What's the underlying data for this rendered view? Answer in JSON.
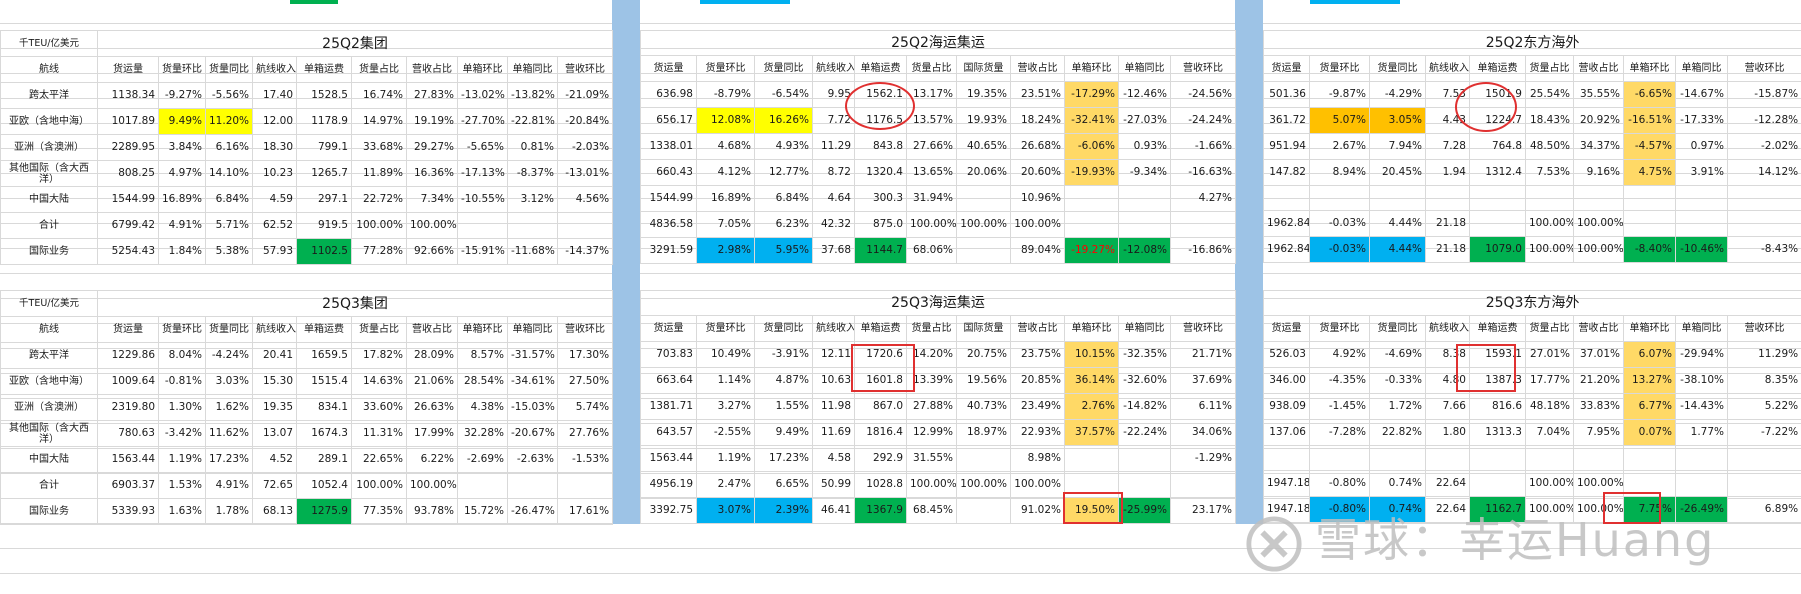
{
  "unit_label": "千TEU/亿美元",
  "route_header": "航线",
  "routes": [
    "跨太平洋",
    "亚欧（含地中海）",
    "亚洲（含澳洲）",
    "其他国际（含大西洋）",
    "中国大陆",
    "合计",
    "国际业务"
  ],
  "headers": {
    "group": [
      "货运量",
      "货量环比",
      "货量同比",
      "航线收入",
      "单箱运费",
      "货量占比",
      "营收占比",
      "单箱环比",
      "单箱同比",
      "营收环比"
    ],
    "sea": [
      "货运量",
      "货量环比",
      "货量同比",
      "航线收入",
      "单箱运费",
      "货量占比",
      "国际货量",
      "营收占比",
      "单箱环比",
      "单箱同比",
      "营收环比"
    ],
    "east": [
      "货运量",
      "货量环比",
      "货量同比",
      "航线收入",
      "单箱运费",
      "货量占比",
      "营收占比",
      "单箱环比",
      "单箱同比",
      "营收环比"
    ]
  },
  "q2": {
    "group_title": "25Q2集团",
    "sea_title": "25Q2海运集运",
    "east_title": "25Q2东方海外",
    "group_rows": [
      [
        "1138.34",
        "-9.27%",
        "-5.56%",
        "17.40",
        "1528.5",
        "16.74%",
        "27.83%",
        "-13.02%",
        "-13.82%",
        "-21.09%"
      ],
      [
        "1017.89",
        "9.49%",
        "11.20%",
        "12.00",
        "1178.9",
        "14.97%",
        "19.19%",
        "-27.70%",
        "-22.81%",
        "-20.84%"
      ],
      [
        "2289.95",
        "3.84%",
        "6.16%",
        "18.30",
        "799.1",
        "33.68%",
        "29.27%",
        "-5.65%",
        "0.81%",
        "-2.03%"
      ],
      [
        "808.25",
        "4.97%",
        "14.10%",
        "10.23",
        "1265.7",
        "11.89%",
        "16.36%",
        "-17.13%",
        "-8.37%",
        "-13.01%"
      ],
      [
        "1544.99",
        "16.89%",
        "6.84%",
        "4.59",
        "297.1",
        "22.72%",
        "7.34%",
        "-10.55%",
        "3.12%",
        "4.56%"
      ],
      [
        "6799.42",
        "4.91%",
        "5.71%",
        "62.52",
        "919.5",
        "100.00%",
        "100.00%",
        "",
        "",
        ""
      ],
      [
        "5254.43",
        "1.84%",
        "5.38%",
        "57.93",
        "1102.5",
        "77.28%",
        "92.66%",
        "-15.91%",
        "-11.68%",
        "-14.37%"
      ]
    ],
    "sea_rows": [
      [
        "636.98",
        "-8.79%",
        "-6.54%",
        "9.95",
        "1562.1",
        "13.17%",
        "19.35%",
        "23.51%",
        "-17.29%",
        "-12.46%",
        "-24.56%"
      ],
      [
        "656.17",
        "12.08%",
        "16.26%",
        "7.72",
        "1176.5",
        "13.57%",
        "19.93%",
        "18.24%",
        "-32.41%",
        "-27.03%",
        "-24.24%"
      ],
      [
        "1338.01",
        "4.68%",
        "4.93%",
        "11.29",
        "843.8",
        "27.66%",
        "40.65%",
        "26.68%",
        "-6.06%",
        "0.93%",
        "-1.66%"
      ],
      [
        "660.43",
        "4.12%",
        "12.77%",
        "8.72",
        "1320.4",
        "13.65%",
        "20.06%",
        "20.60%",
        "-19.93%",
        "-9.34%",
        "-16.63%"
      ],
      [
        "1544.99",
        "16.89%",
        "6.84%",
        "4.64",
        "300.3",
        "31.94%",
        "",
        "10.96%",
        "",
        "",
        "4.27%"
      ],
      [
        "4836.58",
        "7.05%",
        "6.23%",
        "42.32",
        "875.0",
        "100.00%",
        "100.00%",
        "100.00%",
        "",
        "",
        ""
      ],
      [
        "3291.59",
        "2.98%",
        "5.95%",
        "37.68",
        "1144.7",
        "68.06%",
        "",
        "89.04%",
        "-19.27%",
        "-12.08%",
        "-16.86%"
      ]
    ],
    "east_rows": [
      [
        "501.36",
        "-9.87%",
        "-4.29%",
        "7.53",
        "1501.9",
        "25.54%",
        "35.55%",
        "-6.65%",
        "-14.67%",
        "-15.87%"
      ],
      [
        "361.72",
        "5.07%",
        "3.05%",
        "4.43",
        "1224.7",
        "18.43%",
        "20.92%",
        "-16.51%",
        "-17.33%",
        "-12.28%"
      ],
      [
        "951.94",
        "2.67%",
        "7.94%",
        "7.28",
        "764.8",
        "48.50%",
        "34.37%",
        "-4.57%",
        "0.97%",
        "-2.02%"
      ],
      [
        "147.82",
        "8.94%",
        "20.45%",
        "1.94",
        "1312.4",
        "7.53%",
        "9.16%",
        "4.75%",
        "3.91%",
        "14.12%"
      ],
      [
        "",
        "",
        "",
        "",
        "",
        "",
        "",
        "",
        "",
        ""
      ],
      [
        "1962.84",
        "-0.03%",
        "4.44%",
        "21.18",
        "",
        "100.00%",
        "100.00%",
        "",
        "",
        ""
      ],
      [
        "1962.84",
        "-0.03%",
        "4.44%",
        "21.18",
        "1079.0",
        "100.00%",
        "100.00%",
        "-8.40%",
        "-10.46%",
        "-8.43%"
      ]
    ]
  },
  "q3": {
    "group_title": "25Q3集团",
    "sea_title": "25Q3海运集运",
    "east_title": "25Q3东方海外",
    "group_rows": [
      [
        "1229.86",
        "8.04%",
        "-4.24%",
        "20.41",
        "1659.5",
        "17.82%",
        "28.09%",
        "8.57%",
        "-31.57%",
        "17.30%"
      ],
      [
        "1009.64",
        "-0.81%",
        "3.03%",
        "15.30",
        "1515.4",
        "14.63%",
        "21.06%",
        "28.54%",
        "-34.61%",
        "27.50%"
      ],
      [
        "2319.80",
        "1.30%",
        "1.62%",
        "19.35",
        "834.1",
        "33.60%",
        "26.63%",
        "4.38%",
        "-15.03%",
        "5.74%"
      ],
      [
        "780.63",
        "-3.42%",
        "11.62%",
        "13.07",
        "1674.3",
        "11.31%",
        "17.99%",
        "32.28%",
        "-20.67%",
        "27.76%"
      ],
      [
        "1563.44",
        "1.19%",
        "17.23%",
        "4.52",
        "289.1",
        "22.65%",
        "6.22%",
        "-2.69%",
        "-2.63%",
        "-1.53%"
      ],
      [
        "6903.37",
        "1.53%",
        "4.91%",
        "72.65",
        "1052.4",
        "100.00%",
        "100.00%",
        "",
        "",
        ""
      ],
      [
        "5339.93",
        "1.63%",
        "1.78%",
        "68.13",
        "1275.9",
        "77.35%",
        "93.78%",
        "15.72%",
        "-26.47%",
        "17.61%"
      ]
    ],
    "sea_rows": [
      [
        "703.83",
        "10.49%",
        "-3.91%",
        "12.11",
        "1720.6",
        "14.20%",
        "20.75%",
        "23.75%",
        "10.15%",
        "-32.35%",
        "21.71%"
      ],
      [
        "663.64",
        "1.14%",
        "4.87%",
        "10.63",
        "1601.8",
        "13.39%",
        "19.56%",
        "20.85%",
        "36.14%",
        "-32.60%",
        "37.69%"
      ],
      [
        "1381.71",
        "3.27%",
        "1.55%",
        "11.98",
        "867.0",
        "27.88%",
        "40.73%",
        "23.49%",
        "2.76%",
        "-14.82%",
        "6.11%"
      ],
      [
        "643.57",
        "-2.55%",
        "9.49%",
        "11.69",
        "1816.4",
        "12.99%",
        "18.97%",
        "22.93%",
        "37.57%",
        "-22.24%",
        "34.06%"
      ],
      [
        "1563.44",
        "1.19%",
        "17.23%",
        "4.58",
        "292.9",
        "31.55%",
        "",
        "8.98%",
        "",
        "",
        "-1.29%"
      ],
      [
        "4956.19",
        "2.47%",
        "6.65%",
        "50.99",
        "1028.8",
        "100.00%",
        "100.00%",
        "100.00%",
        "",
        "",
        ""
      ],
      [
        "3392.75",
        "3.07%",
        "2.39%",
        "46.41",
        "1367.9",
        "68.45%",
        "",
        "91.02%",
        "19.50%",
        "-25.99%",
        "23.17%"
      ]
    ],
    "east_rows": [
      [
        "526.03",
        "4.92%",
        "-4.69%",
        "8.38",
        "1593.1",
        "27.01%",
        "37.01%",
        "6.07%",
        "-29.94%",
        "11.29%"
      ],
      [
        "346.00",
        "-4.35%",
        "-0.33%",
        "4.80",
        "1387.3",
        "17.77%",
        "21.20%",
        "13.27%",
        "-38.10%",
        "8.35%"
      ],
      [
        "938.09",
        "-1.45%",
        "1.72%",
        "7.66",
        "816.6",
        "48.18%",
        "33.83%",
        "6.77%",
        "-14.43%",
        "5.22%"
      ],
      [
        "137.06",
        "-7.28%",
        "22.82%",
        "1.80",
        "1313.3",
        "7.04%",
        "7.95%",
        "0.07%",
        "1.77%",
        "-7.22%"
      ],
      [
        "",
        "",
        "",
        "",
        "",
        "",
        "",
        "",
        "",
        ""
      ],
      [
        "1947.18",
        "-0.80%",
        "0.74%",
        "22.64",
        "",
        "100.00%",
        "100.00%",
        "",
        "",
        ""
      ],
      [
        "1947.18",
        "-0.80%",
        "0.74%",
        "22.64",
        "1162.7",
        "100.00%",
        "100.00%",
        "7.75%",
        "-26.49%",
        "6.89%"
      ]
    ]
  },
  "watermark": "雪球：幸运Huang",
  "colors": {
    "yellow": "#ffff00",
    "orange": "#ffc000",
    "light_orange": "#ffd966",
    "green": "#00b050",
    "blue": "#00b0f0",
    "separator": "#9dc3e6",
    "annotation_red": "#e03030"
  }
}
